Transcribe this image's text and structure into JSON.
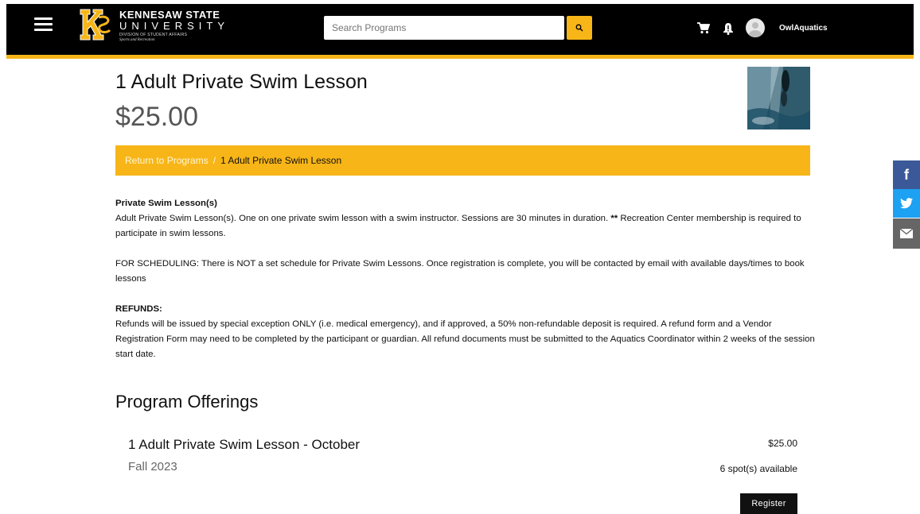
{
  "header": {
    "logo": {
      "line1": "KENNESAW STATE",
      "line2": "UNIVERSITY",
      "line3": "DIVISION OF STUDENT AFFAIRS",
      "line4": "Sports and Recreation"
    },
    "search": {
      "placeholder": "Search Programs",
      "value": ""
    },
    "username": "OwlAquatics",
    "colors": {
      "bar": "#000000",
      "accent": "#f7b518"
    },
    "icons": [
      "menu-icon",
      "search-icon",
      "cart-icon",
      "bell-icon",
      "avatar"
    ]
  },
  "program": {
    "title": "1 Adult Private Swim Lesson",
    "price": "$25.00"
  },
  "breadcrumb": {
    "link": "Return to Programs",
    "separator": "/",
    "current": "1 Adult Private Swim Lesson"
  },
  "description": {
    "heading1": "Private Swim Lesson(s)",
    "text1_part1": "Adult Private Swim Lesson(s). One on one private swim lesson with a swim instructor. Sessions are 30 minutes in duration. ",
    "text1_bold": "**",
    "text1_part2": " Recreation Center membership is required to participate in swim lessons.",
    "text2": "FOR SCHEDULING: There is NOT a set schedule for Private Swim Lessons. Once registration is complete, you will be contacted by email with available days/times to book lessons",
    "heading2": "REFUNDS:",
    "text3": "Refunds will be issued by special exception ONLY (i.e. medical emergency), and if approved, a 50% non-refundable deposit is required. A refund form and a Vendor Registration Form may need to be completed by the participant or guardian. All refund documents must be submitted to the Aquatics Coordinator within 2 weeks of the session start date."
  },
  "offerings": {
    "title": "Program Offerings",
    "items": [
      {
        "title": "1 Adult Private Swim Lesson - October",
        "term": "Fall 2023",
        "price": "$25.00",
        "spots": "6 spot(s) available",
        "button": "Register"
      }
    ]
  },
  "social": {
    "facebook_glyph": "f",
    "icons": [
      "facebook-icon",
      "twitter-icon",
      "email-icon"
    ],
    "colors": {
      "facebook": "#3b5998",
      "twitter": "#1da1f2",
      "email": "#666666"
    }
  }
}
